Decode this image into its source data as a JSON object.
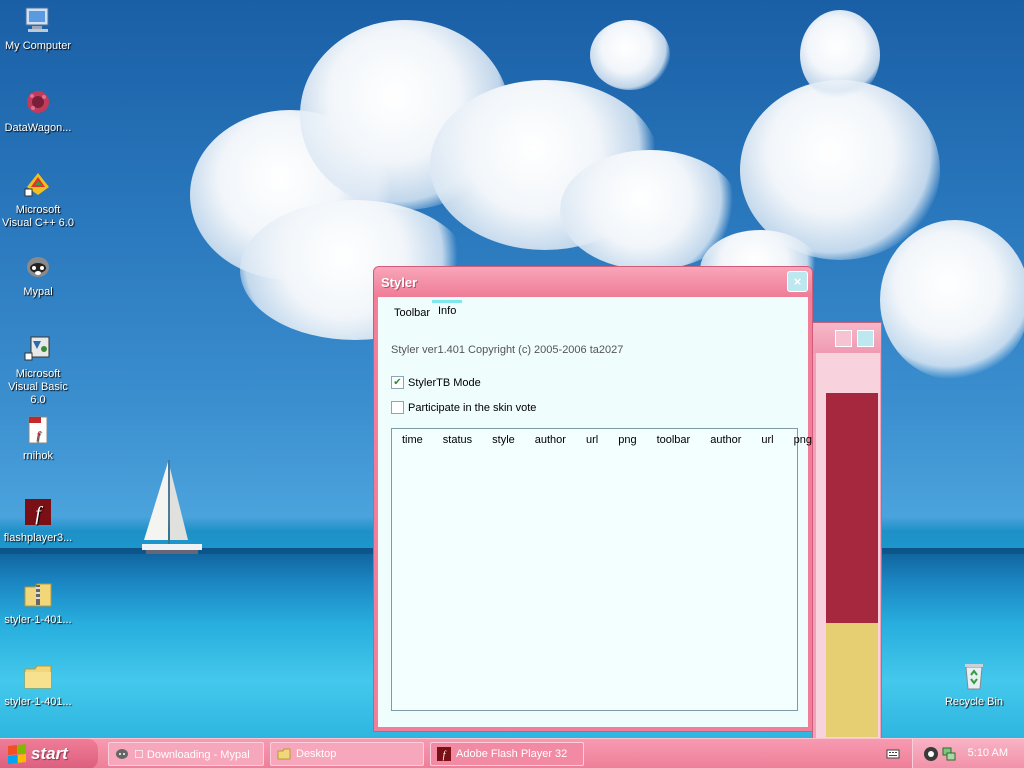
{
  "desktop": {
    "icons": [
      {
        "label": "My Computer",
        "icon": "computer-icon"
      },
      {
        "label": "DataWagon...",
        "icon": "datawagon-icon"
      },
      {
        "label": "Microsoft Visual C++ 6.0",
        "icon": "visual-cpp-icon"
      },
      {
        "label": "Mypal",
        "icon": "mypal-icon"
      },
      {
        "label": "Microsoft Visual Basic 6.0",
        "icon": "visual-basic-icon"
      },
      {
        "label": "rnihok",
        "icon": "swf-file-icon"
      },
      {
        "label": "flashplayer3...",
        "icon": "flash-player-icon"
      },
      {
        "label": "styler-1-401...",
        "icon": "zip-folder-icon"
      },
      {
        "label": "styler-1-401...",
        "icon": "folder-icon"
      },
      {
        "label": "Recycle Bin",
        "icon": "recycle-bin-icon"
      }
    ]
  },
  "window": {
    "title": "Styler",
    "close_glyph": "×",
    "tabs": [
      {
        "label": "Toolbar",
        "active": false
      },
      {
        "label": "Info",
        "active": true
      }
    ],
    "version_text": "Styler ver1.401  Copyright (c) 2005-2006 ta2027",
    "checkboxes": [
      {
        "label": "StylerTB Mode",
        "checked": true
      },
      {
        "label": "Participate in the skin vote",
        "checked": false
      }
    ],
    "list_columns": [
      "time",
      "status",
      "style",
      "author",
      "url",
      "png",
      "toolbar",
      "author",
      "url",
      "png"
    ]
  },
  "taskbar": {
    "start_label": "start",
    "tasks": [
      {
        "label": "☐ Downloading - Mypal",
        "icon": "mypal-icon"
      },
      {
        "label": "Desktop",
        "icon": "folder-icon"
      },
      {
        "label": "Adobe Flash Player 32",
        "icon": "flash-player-icon"
      }
    ],
    "clock": "5:10 AM"
  },
  "colors": {
    "accent": "#f27e99",
    "client_bg": "#f0fdfd",
    "tab_highlight": "#7fe7ee"
  }
}
